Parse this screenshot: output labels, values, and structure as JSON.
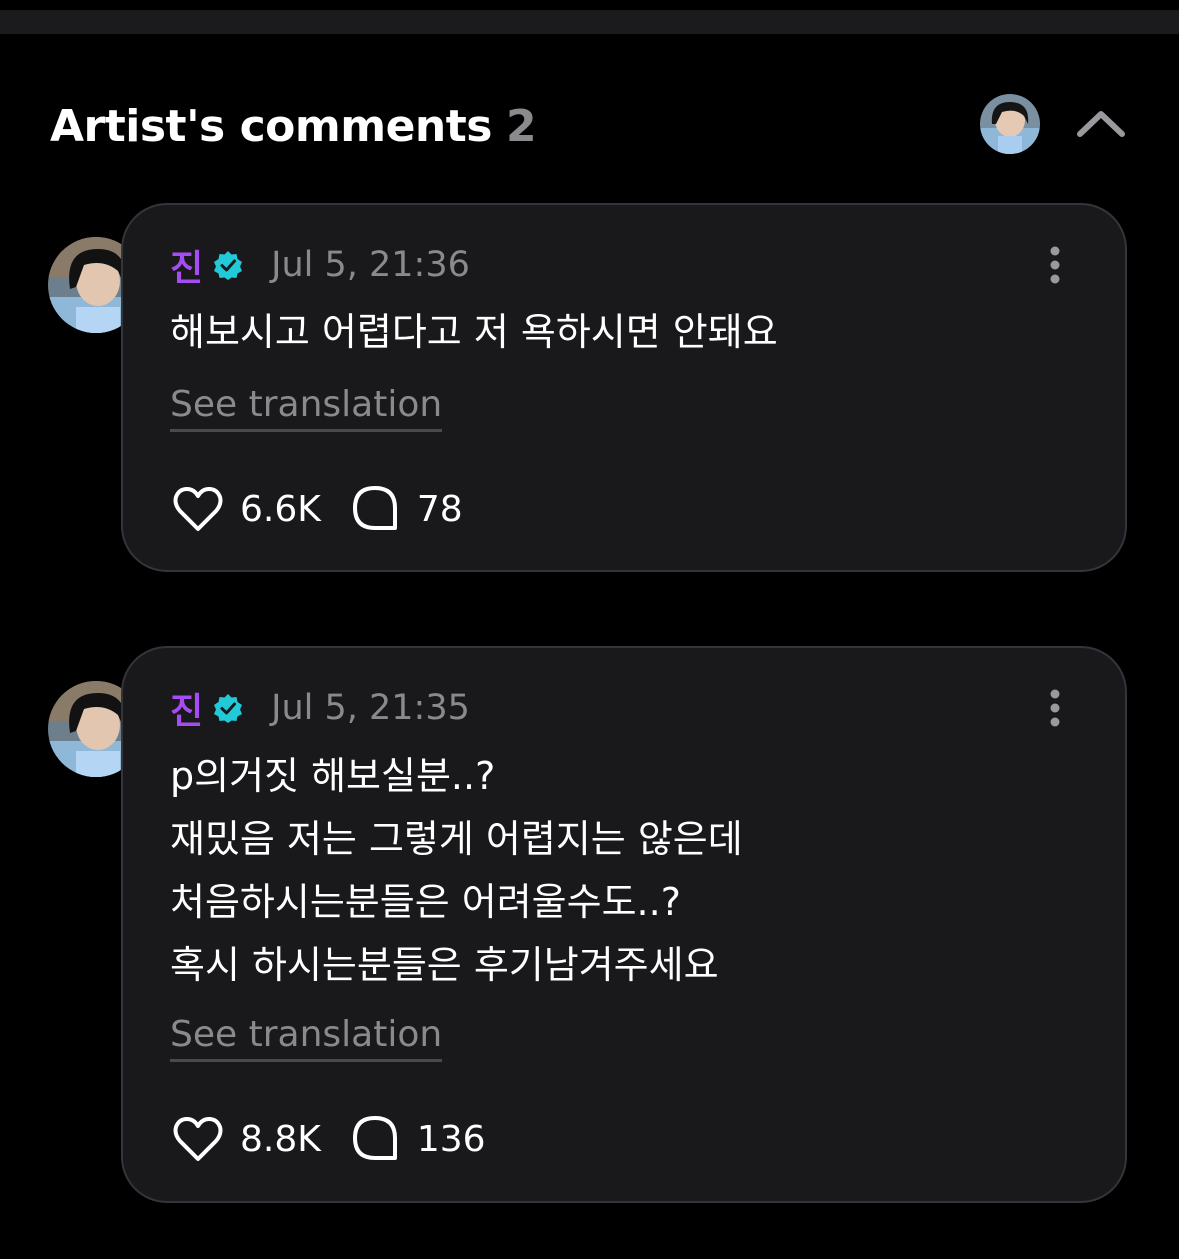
{
  "header": {
    "title": "Artist's comments",
    "count": "2"
  },
  "colors": {
    "background": "#000000",
    "card": "#19191b",
    "author": "#a54cf5",
    "verified": "#22c9d8",
    "muted": "#8a8a8e"
  },
  "comments": [
    {
      "author": "진",
      "verified_icon": "verified-badge-icon",
      "timestamp": "Jul 5, 21:36",
      "text": "해보시고 어렵다고 저 욕하시면 안돼요",
      "translate_label": "See translation",
      "likes": "6.6K",
      "replies": "78"
    },
    {
      "author": "진",
      "verified_icon": "verified-badge-icon",
      "timestamp": "Jul 5, 21:35",
      "text": "p의거짓 해보실분..?\n재밌음 저는 그렇게 어렵지는 않은데\n처음하시는분들은 어려울수도..?\n혹시 하시는분들은 후기남겨주세요",
      "translate_label": "See translation",
      "likes": "8.8K",
      "replies": "136"
    }
  ]
}
